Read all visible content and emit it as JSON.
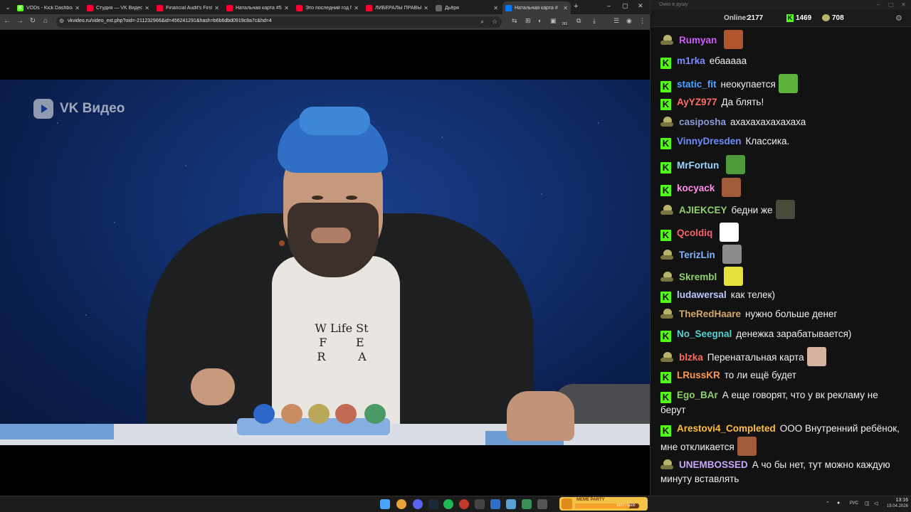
{
  "browser": {
    "tabs": [
      {
        "title": "VODs - Kick Dashboard",
        "favicon": "kick-icon",
        "color": "#53fc18",
        "letter": "K"
      },
      {
        "title": "Студия — VK Видео Li",
        "favicon": "youtube-icon",
        "color": "#ff0033",
        "letter": ""
      },
      {
        "title": "Financial Audit's First I",
        "favicon": "youtube-icon",
        "color": "#ff0033",
        "letter": ""
      },
      {
        "title": "Натальная карта #58 А",
        "favicon": "youtube-icon",
        "color": "#ff0033",
        "letter": ""
      },
      {
        "title": "Это последний год Пу",
        "favicon": "youtube-icon",
        "color": "#ff0033",
        "letter": ""
      },
      {
        "title": "ЛИБЕРАЛЫ ПРАВЫ В",
        "favicon": "youtube-icon",
        "color": "#ff0033",
        "letter": ""
      },
      {
        "title": "Дьёря",
        "favicon": "page-icon",
        "color": "#666666",
        "letter": ""
      },
      {
        "title": "Натальная карта #",
        "favicon": "vk-icon",
        "color": "#0077ff",
        "letter": ""
      }
    ],
    "url": "vkvideo.ru/video_ext.php?oid=-211232966&id=456241291&hash=b6b6dbd0919c8a7c&hd=4",
    "ext_badge": "283"
  },
  "video": {
    "logo_text": "VK Видео",
    "shirt_print": "W Life St\nF        E\nR         A"
  },
  "chat": {
    "window_title": "Окно в душу",
    "online_label": "Online:",
    "online_value": "2177",
    "kick_count": "1469",
    "vk_count": "708",
    "messages": [
      {
        "platform": "vk",
        "user": "Rumyan",
        "color": "#d05cff",
        "text": "",
        "emote": "face-emote",
        "emote_color": "#b0552e"
      },
      {
        "platform": "kick",
        "user": "m1rka",
        "color": "#7a8cff",
        "text": "ебааааа",
        "emote": "",
        "emote_color": ""
      },
      {
        "platform": "kick",
        "user": "static_fit",
        "color": "#4aa3ff",
        "text": "неокупается",
        "emote": "pepe-emote",
        "emote_color": "#5db33c"
      },
      {
        "platform": "kick",
        "user": "AyYZ977",
        "color": "#ff6b6b",
        "text": "Да блять!",
        "emote": "",
        "emote_color": ""
      },
      {
        "platform": "vk",
        "user": "casiposha",
        "color": "#8a9bd8",
        "text": "ахахахахахахаха",
        "emote": "",
        "emote_color": ""
      },
      {
        "platform": "kick",
        "user": "VinnyDresden",
        "color": "#6d8cff",
        "text": "Классика.",
        "emote": "",
        "emote_color": ""
      },
      {
        "platform": "kick",
        "user": "MrFortun",
        "color": "#9ad6ff",
        "text": "",
        "emote": "pepe-emote",
        "emote_color": "#4f9a3a"
      },
      {
        "platform": "kick",
        "user": "kocyack",
        "color": "#ff8fe6",
        "text": "",
        "emote": "face-emote",
        "emote_color": "#a15d3a"
      },
      {
        "platform": "vk",
        "user": "AJIEKCEY",
        "color": "#8fd16b",
        "text": "бедни же",
        "emote": "dark-emote",
        "emote_color": "#4a4a3a"
      },
      {
        "platform": "kick",
        "user": "Qcoldiq",
        "color": "#ff5f6d",
        "text": "",
        "emote": "smile-emote",
        "emote_color": "#ffffff"
      },
      {
        "platform": "vk",
        "user": "TerizLin",
        "color": "#7fb3ff",
        "text": "",
        "emote": "cat-emote",
        "emote_color": "#8c8c8c"
      },
      {
        "platform": "vk",
        "user": "Skrembl",
        "color": "#8fd16b",
        "text": "",
        "emote": "small-emote",
        "emote_color": "#e8e03a"
      },
      {
        "platform": "kick",
        "user": "ludawersal",
        "color": "#b9c8ff",
        "text": "как телек)",
        "emote": "",
        "emote_color": ""
      },
      {
        "platform": "vk",
        "user": "TheRedHaare",
        "color": "#d4a86a",
        "text": "нужно больше денег",
        "emote": "",
        "emote_color": ""
      },
      {
        "platform": "kick",
        "user": "No_Seegnal",
        "color": "#56d0d0",
        "text": "денежка зарабатывается)",
        "emote": "",
        "emote_color": ""
      },
      {
        "platform": "vk",
        "user": "blzka",
        "color": "#ff6b5b",
        "text": "Перенатальная карта",
        "emote": "face-emote",
        "emote_color": "#d8b2a0"
      },
      {
        "platform": "kick",
        "user": "LRussKR",
        "color": "#ff9a4a",
        "text": "то ли ещё будет",
        "emote": "",
        "emote_color": ""
      },
      {
        "platform": "kick",
        "user": "Ego_BAr",
        "color": "#8fd16b",
        "text": "А еще говорят, что у вк рекламу не берут",
        "emote": "",
        "emote_color": ""
      },
      {
        "platform": "kick",
        "user": "Arestovi4_Completed",
        "color": "#ffbf3a",
        "text": "ООО Внутренний ребёнок, мне откликается",
        "emote": "face-emote",
        "emote_color": "#a15d3a"
      },
      {
        "platform": "vk",
        "user": "UNEMBOSSED",
        "color": "#c7a6ff",
        "text": "А чо бы нет, тут можно каждую минуту вставлять",
        "emote": "",
        "emote_color": ""
      }
    ]
  },
  "taskbar": {
    "meme_title": "MEME PARTY",
    "meme_progress_text": "1277 / 1500",
    "meme_progress_fraction": 0.85,
    "lang": "РУС",
    "time": "13:16",
    "date": "19.04.2026"
  }
}
